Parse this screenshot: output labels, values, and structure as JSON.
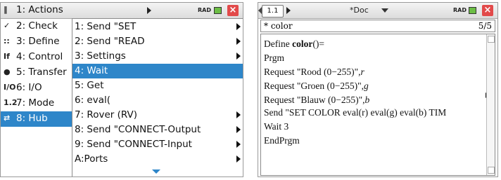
{
  "left_screen": {
    "status": {
      "mode": "RAD"
    },
    "main_menu": [
      {
        "icon": "‖",
        "label": "1: Actions"
      },
      {
        "icon": "✓",
        "label": "2: Check"
      },
      {
        "icon": "::",
        "label": "3: Define"
      },
      {
        "icon": "If",
        "label": "4: Control"
      },
      {
        "icon": "●",
        "label": "5: Transfer"
      },
      {
        "icon": "I/O",
        "label": "6: I/O"
      },
      {
        "icon": "1.2",
        "label": "7: Mode"
      },
      {
        "icon": "⇄",
        "label": "8: Hub"
      }
    ],
    "submenu": [
      {
        "label": "1: Send \"SET",
        "has_arrow": true
      },
      {
        "label": "2: Send \"READ",
        "has_arrow": true
      },
      {
        "label": "3: Settings",
        "has_arrow": true
      },
      {
        "label": "4: Wait",
        "has_arrow": false
      },
      {
        "label": "5: Get",
        "has_arrow": false
      },
      {
        "label": "6: eval(",
        "has_arrow": false
      },
      {
        "label": "7: Rover (RV)",
        "has_arrow": true
      },
      {
        "label": "8: Send \"CONNECT-Output",
        "has_arrow": true
      },
      {
        "label": "9: Send \"CONNECT-Input",
        "has_arrow": true
      },
      {
        "label": "A:Ports",
        "has_arrow": true
      }
    ]
  },
  "right_screen": {
    "tab_label": "1.1",
    "doc_title": "*Doc",
    "status": {
      "mode": "RAD"
    },
    "editor_name": "* color",
    "line_count": "5/5",
    "code": {
      "l1_prefix": "Define ",
      "l1_name": "color",
      "l1_suffix": "()=",
      "l2": "Prgm",
      "l3": "Request \"Rood (0−255)\",",
      "l3_var": "r",
      "l4": "Request \"Groen (0−255)\",",
      "l4_var": "g",
      "l5": "Request \"Blauw (0−255)\",",
      "l5_var": "b",
      "l6": "Send \"SET COLOR eval(r) eval(g) eval(b) TIM",
      "l7": "Wait 3",
      "l8": "EndPrgm"
    }
  },
  "colors": {
    "highlight": "#2e86c9",
    "battery": "#6cbe45",
    "close": "#e24a4a"
  }
}
